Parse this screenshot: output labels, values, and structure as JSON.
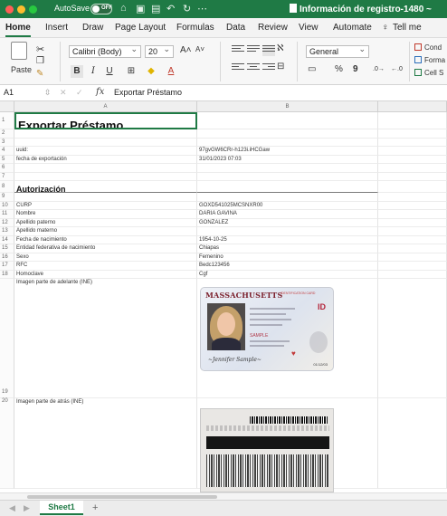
{
  "titlebar": {
    "autosave_label": "AutoSave",
    "autosave_state": "OFF",
    "filename": "Información de registro-1480 ~"
  },
  "menu": [
    "Home",
    "Insert",
    "Draw",
    "Page Layout",
    "Formulas",
    "Data",
    "Review",
    "View",
    "Automate",
    "Tell me"
  ],
  "ribbon": {
    "paste_label": "Paste",
    "font_name": "Calibri (Body)",
    "font_size": "20",
    "number_format": "General",
    "percent": "%",
    "comma": "9",
    "styles": [
      "Cond",
      "Forma",
      "Cell S"
    ]
  },
  "formula_bar": {
    "name_box": "A1",
    "fx": "fx",
    "content": "Exportar Préstamo"
  },
  "columns": [
    "A",
    "B"
  ],
  "rows": {
    "r1_a": "Exportar Préstamo",
    "r4_a": "uuid:",
    "r4_b": "97gvGW6CRr-h123i.iHCGaw",
    "r5_a": "fecha de exportación",
    "r5_b": "31/01/2023 07:03",
    "r8_a": "Autorización",
    "r10_a": "CURP",
    "r10_b": "GOXD541025MCSNXR00",
    "r11_a": "Nombre",
    "r11_b": "DARIA GAVINA",
    "r12_a": "Apellido paterno",
    "r12_b": "GONZALEZ",
    "r13_a": "Apellido materno",
    "r14_a": "Fecha de nacimiento",
    "r14_b": "1954-10-25",
    "r15_a": "Entidad federativa de nacimiento",
    "r15_b": "Chiapas",
    "r16_a": "Sexo",
    "r16_b": "Femenino",
    "r17_a": "RFC",
    "r17_b": "Bedc123456",
    "r18_a": "Homoclave",
    "r18_b": "Cgf",
    "r19_a": "Imagen parte de adelante (INE)",
    "r20_a": "Imagen parte de atrás (INE)"
  },
  "id_front": {
    "state": "MASSACHUSETTS",
    "sub": "IDENTIFICATION CARD",
    "badge": "ID",
    "sample": "SAMPLE",
    "expires": "01/12/03"
  },
  "sheet_tab": "Sheet1"
}
